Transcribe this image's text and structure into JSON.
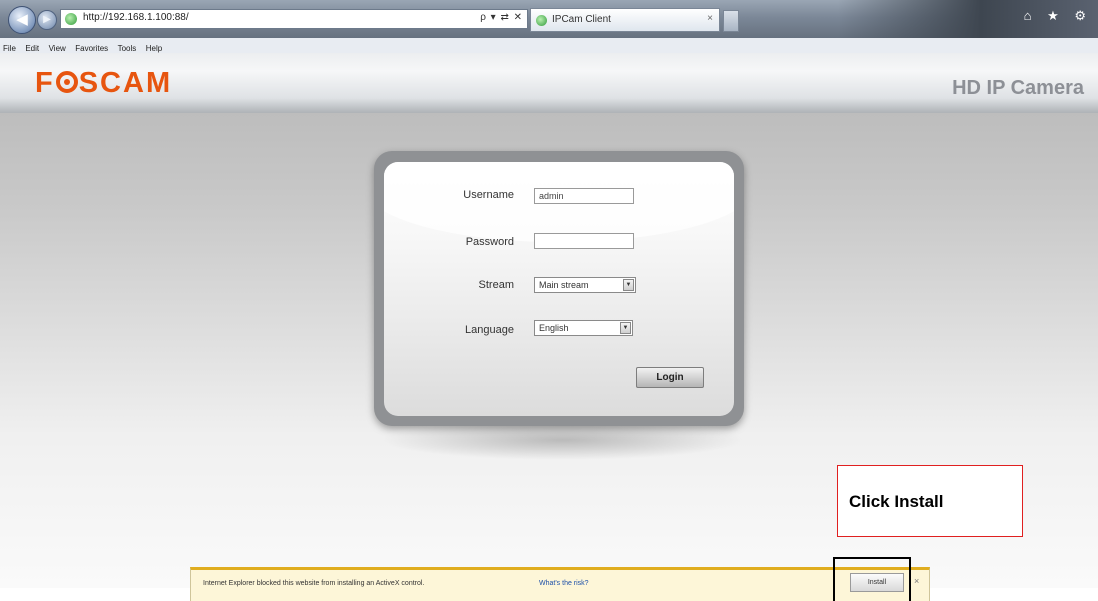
{
  "browser": {
    "back_glyph": "◀",
    "forward_glyph": "▶",
    "url": "http://192.168.1.100:88/",
    "address_tools": "ρ ▾ ⇄ ✕",
    "tab_title": "IPCam Client",
    "tab_close": "×",
    "window_controls": "⌂ ★ ⚙",
    "menu": [
      "File",
      "Edit",
      "View",
      "Favorites",
      "Tools",
      "Help"
    ]
  },
  "header": {
    "brand_left": "F",
    "brand_right": "SCAM",
    "product_title": "HD IP Camera",
    "brand_color": "#e7550f"
  },
  "login": {
    "username_label": "Username",
    "username_value": "admin",
    "password_label": "Password",
    "password_value": "",
    "stream_label": "Stream",
    "stream_value": "Main stream",
    "language_label": "Language",
    "language_value": "English",
    "select_arrow": "▼",
    "login_button": "Login"
  },
  "infobar": {
    "message": "Internet Explorer blocked this website from installing an ActiveX control.",
    "link": "What's the risk?",
    "install_button": "Install",
    "close_glyph": "×"
  },
  "annotation": {
    "callout_text": "Click Install",
    "callout_color": "#e02020"
  }
}
